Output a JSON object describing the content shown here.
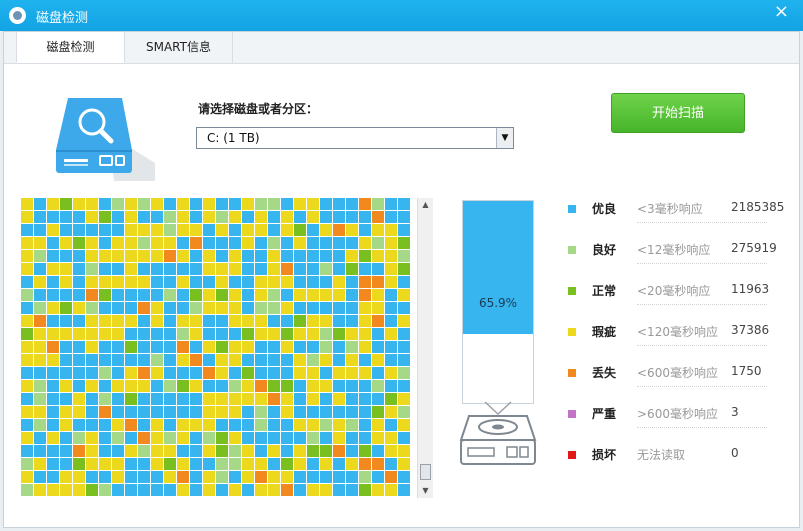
{
  "window": {
    "title": "磁盘检测",
    "close_label": "×"
  },
  "tabs": [
    {
      "label": "磁盘检测"
    },
    {
      "label": "SMART信息"
    }
  ],
  "select": {
    "label": "请选择磁盘或者分区：",
    "value": "C:  (1 TB)",
    "arrow": "▼"
  },
  "start_button": {
    "label": "开始扫描"
  },
  "progress": {
    "percent_label": "65.9%",
    "fill_fraction": 0.659
  },
  "legend": [
    {
      "name": "优良",
      "desc": "<3毫秒响应",
      "count": "2185385",
      "color": "#36b5ef"
    },
    {
      "name": "良好",
      "desc": "<12毫秒响应",
      "count": "275919",
      "color": "#a6d987"
    },
    {
      "name": "正常",
      "desc": "<20毫秒响应",
      "count": "11963",
      "color": "#78bf1f"
    },
    {
      "name": "瑕疵",
      "desc": "<120毫秒响应",
      "count": "37386",
      "color": "#ecd81c"
    },
    {
      "name": "丢失",
      "desc": "<600毫秒响应",
      "count": "1750",
      "color": "#f2891e"
    },
    {
      "name": "严重",
      "desc": ">600毫秒响应",
      "count": "3",
      "color": "#c373c6"
    },
    {
      "name": "损坏",
      "desc": "无法读取",
      "count": "0",
      "color": "#e01818"
    }
  ],
  "scrollbar": {
    "up": "▲",
    "down": "▼"
  }
}
